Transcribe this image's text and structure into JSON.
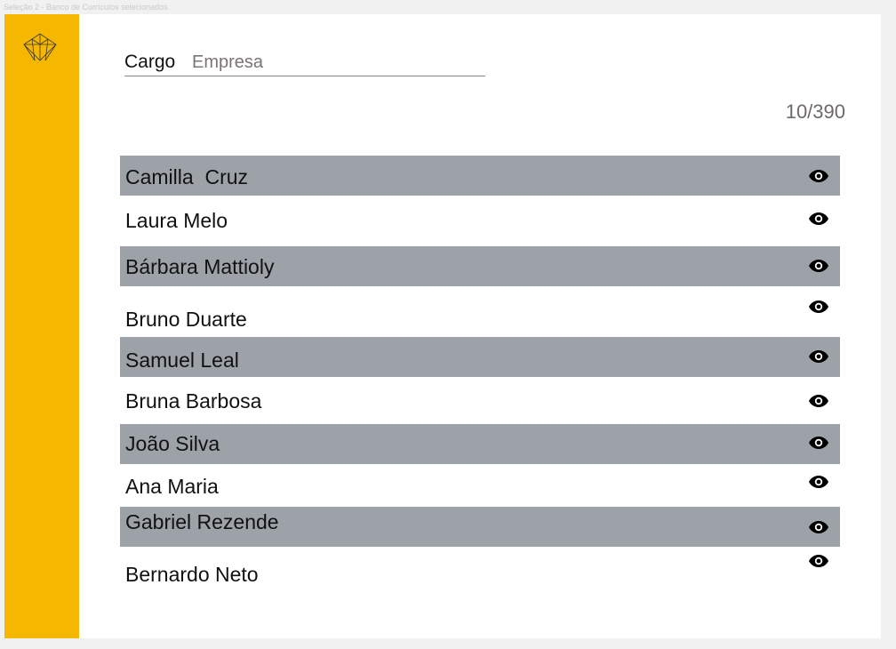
{
  "frame_title": "Seleção 2 - Banco de Currículos selecionados",
  "colors": {
    "sidebar": "#f6b700",
    "row_shaded": "#9da1a8",
    "text": "#111111",
    "muted": "#7c7474"
  },
  "search": {
    "label": "Cargo",
    "placeholder": "Empresa"
  },
  "pagination": {
    "counter": "10/390"
  },
  "candidates": [
    {
      "name": "Camilla  Cruz",
      "icon": "eye-icon"
    },
    {
      "name": "Laura Melo",
      "icon": "eye-icon"
    },
    {
      "name": "Bárbara Mattioly",
      "icon": "eye-icon"
    },
    {
      "name": "Bruno Duarte",
      "icon": "eye-icon"
    },
    {
      "name": "Samuel Leal",
      "icon": "eye-icon"
    },
    {
      "name": "Bruna Barbosa",
      "icon": "eye-icon"
    },
    {
      "name": "João Silva",
      "icon": "eye-icon"
    },
    {
      "name": "Ana Maria",
      "icon": "eye-icon"
    },
    {
      "name": "Gabriel Rezende",
      "icon": "eye-icon"
    },
    {
      "name": "Bernardo Neto",
      "icon": "eye-icon"
    }
  ]
}
